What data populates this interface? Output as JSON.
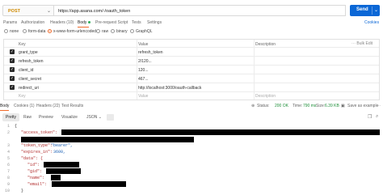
{
  "request": {
    "method": "POST",
    "url": "https://app.asana.com/-/oauth_token",
    "send_label": "Send"
  },
  "request_tabs": [
    "Params",
    "Authorization",
    "Headers (10)",
    "Body",
    "Pre-request Script",
    "Tests",
    "Settings"
  ],
  "cookies_label": "Cookies",
  "body_types": [
    "none",
    "form-data",
    "x-www-form-urlencoded",
    "raw",
    "binary",
    "GraphQL"
  ],
  "params_table": {
    "headers": [
      "Key",
      "Value",
      "Description"
    ],
    "bulk_edit": "Bulk Edit",
    "rows": [
      {
        "key": "grant_type",
        "value": "refresh_token"
      },
      {
        "key": "refresh_token",
        "value": "2/120..."
      },
      {
        "key": "client_id",
        "value": "120..."
      },
      {
        "key": "client_secret",
        "value": "467..."
      },
      {
        "key": "redirect_uri",
        "value": "http://localhost:3000/oauth-callback"
      }
    ],
    "empty_row": {
      "key": "Key",
      "value": "Value",
      "description": "Description"
    }
  },
  "response_tabs": [
    "Body",
    "Cookies (1)",
    "Headers (22)",
    "Test Results"
  ],
  "response_status": {
    "status_label": "Status:",
    "status_value": "200 OK",
    "time_label": "Time:",
    "time_value": "790 ms",
    "size_label": "Size:",
    "size_value": "6.39 KB",
    "save_label": "Save as example"
  },
  "view_modes": [
    "Pretty",
    "Raw",
    "Preview",
    "Visualize"
  ],
  "format": "JSON",
  "json_lines": {
    "l1": "{",
    "l2_key": "\"access_token\": ",
    "l4_key": "\"token_type\": ",
    "l4_val": "\"bearer\",",
    "l5_key": "\"expires_in\": ",
    "l5_val": "3600,",
    "l6_key": "\"data\": {",
    "l7_key": "\"id\": ",
    "l8_key": "\"gid\": ",
    "l9_key": "\"name\": ",
    "l10_key": "\"email\": ",
    "l11": "}",
    "l12": "}"
  }
}
